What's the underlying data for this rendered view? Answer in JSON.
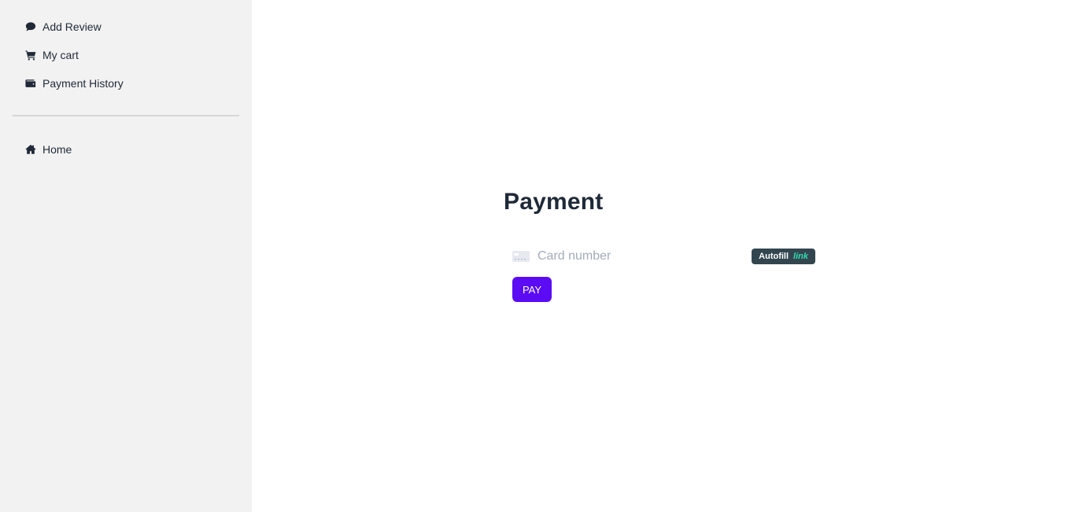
{
  "sidebar": {
    "items": [
      {
        "label": "Add Review",
        "icon": "comment-icon"
      },
      {
        "label": "My cart",
        "icon": "cart-icon"
      },
      {
        "label": "Payment History",
        "icon": "wallet-icon"
      }
    ],
    "secondary_items": [
      {
        "label": "Home",
        "icon": "home-icon"
      }
    ]
  },
  "main": {
    "title": "Payment",
    "card_field": {
      "value": "",
      "placeholder": "Card number"
    },
    "autofill": {
      "label": "Autofill",
      "brand": "link"
    },
    "pay_button": "PAY"
  },
  "colors": {
    "sidebar_bg": "#f2f2f2",
    "pay_button": "#5b0cf5",
    "autofill_bg": "#33464f",
    "link_brand": "#33ddb3"
  }
}
